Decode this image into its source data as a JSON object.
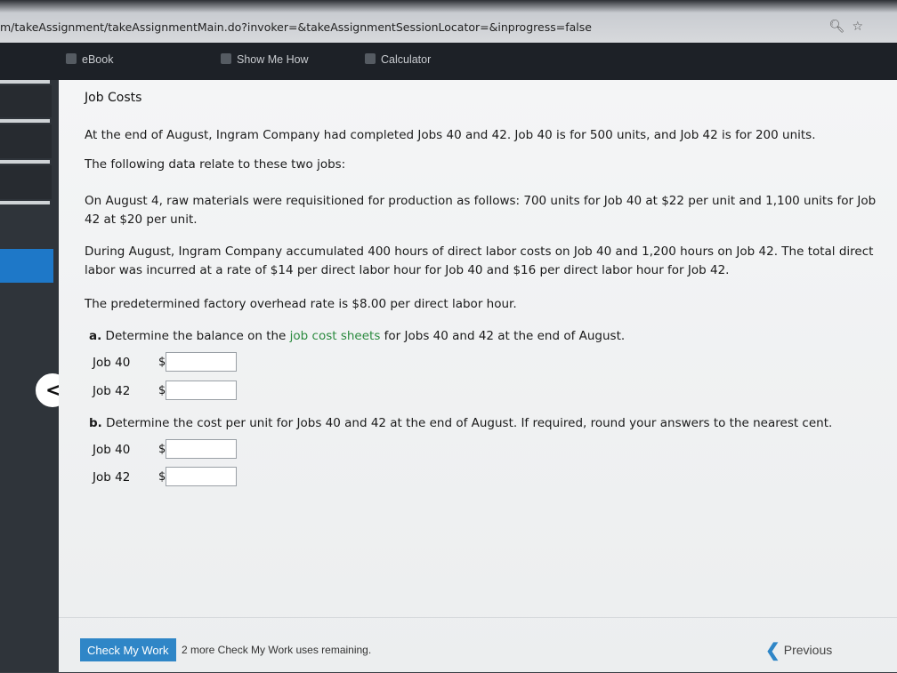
{
  "address_bar": {
    "url": "m/takeAssignment/takeAssignmentMain.do?invoker=&takeAssignmentSessionLocator=&inprogress=false",
    "icons": [
      "zoom-icon",
      "star-icon"
    ]
  },
  "toolbar": {
    "items": [
      {
        "label": "eBook",
        "icon": "book-icon"
      },
      {
        "label": "Show Me How",
        "icon": "video-icon"
      },
      {
        "label": "Calculator",
        "icon": "calculator-icon"
      }
    ]
  },
  "content": {
    "title": "Job Costs",
    "paragraphs": [
      "At the end of August, Ingram Company had completed Jobs 40 and 42. Job 40 is for 500 units, and Job 42 is for 200 units.",
      "The following data relate to these two jobs:",
      "On August 4, raw materials were requisitioned for production as follows: 700 units for Job 40 at $22 per unit and 1,100 units for Job 42 at $20 per unit.",
      "During August, Ingram Company accumulated 400 hours of direct labor costs on Job 40 and 1,200 hours on Job 42. The total direct labor was incurred at a rate of $14 per direct labor hour for Job 40 and $16 per direct labor hour for Job 42.",
      "The predetermined factory overhead rate is $8.00 per direct labor hour."
    ],
    "question_a": {
      "letter": "a.",
      "text_before": "Determine the balance on the",
      "link": "job cost sheets",
      "text_after": "for Jobs 40 and 42 at the end of August.",
      "rows": [
        {
          "label": "Job 40",
          "currency": "$",
          "value": ""
        },
        {
          "label": "Job 42",
          "currency": "$",
          "value": ""
        }
      ]
    },
    "question_b": {
      "letter": "b.",
      "text": "Determine the cost per unit for Jobs 40 and 42 at the end of August. If required, round your answers to the nearest cent.",
      "rows": [
        {
          "label": "Job 40",
          "currency": "$",
          "value": ""
        },
        {
          "label": "Job 42",
          "currency": "$",
          "value": ""
        }
      ]
    }
  },
  "footer": {
    "check_button": "Check My Work",
    "remaining_text": "2 more Check My Work uses remaining.",
    "previous_label": "Previous"
  },
  "colors": {
    "accent": "#2f86c7",
    "link": "#2a8a3e",
    "toolbar_bg": "#1d2127"
  }
}
